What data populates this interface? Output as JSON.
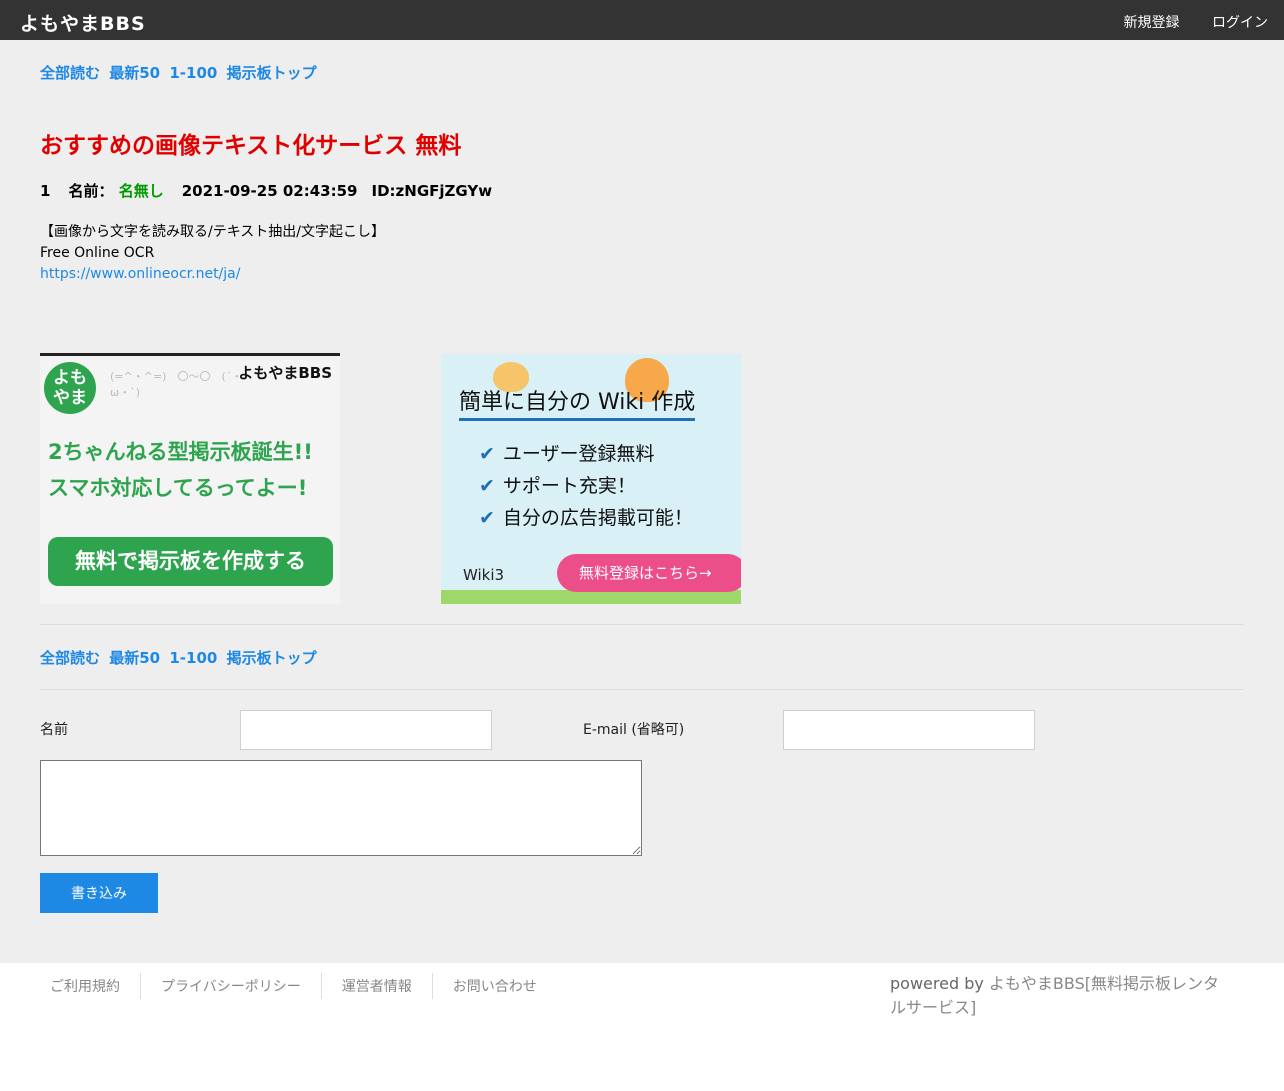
{
  "header": {
    "logo": "よもやまBBS",
    "register": "新規登録",
    "login": "ログイン"
  },
  "nav": {
    "read_all": "全部読む",
    "latest50": "最新50",
    "range": "1-100",
    "board_top": "掲示板トップ"
  },
  "thread": {
    "title": "おすすめの画像テキスト化サービス 無料"
  },
  "post": {
    "number": "1",
    "name_label": "名前：",
    "name": "名無し",
    "date": "2021-09-25 02:43:59",
    "id": "ID:zNGFjZGYw",
    "line1": "【画像から文字を読み取る/テキスト抽出/文字起こし】",
    "line2": "Free Online OCR",
    "link": "https://www.onlineocr.net/ja/"
  },
  "banner_bbs": {
    "badge": "よも やま",
    "brand": "よもやまBBS",
    "headline1": "2ちゃんねる型掲示板誕生!!",
    "headline2": "スマホ対応してるってよー!",
    "button": "無料で掲示板を作成する"
  },
  "banner_wiki": {
    "title": "簡単に自分の Wiki 作成",
    "items": [
      "ユーザー登録無料",
      "サポート充実！",
      "自分の広告掲載可能！"
    ],
    "brand": "Wiki3",
    "button": "無料登録はこちら→",
    "check": "✔"
  },
  "form": {
    "name_label": "名前",
    "email_label": "E-mail (省略可)",
    "submit": "書き込み"
  },
  "footer": {
    "links": [
      "ご利用規約",
      "プライバシーポリシー",
      "運営者情報",
      "お問い合わせ"
    ],
    "powered_prefix": "powered by ",
    "powered_link": "よもやまBBS[無料掲示板レンタルサービス]"
  }
}
